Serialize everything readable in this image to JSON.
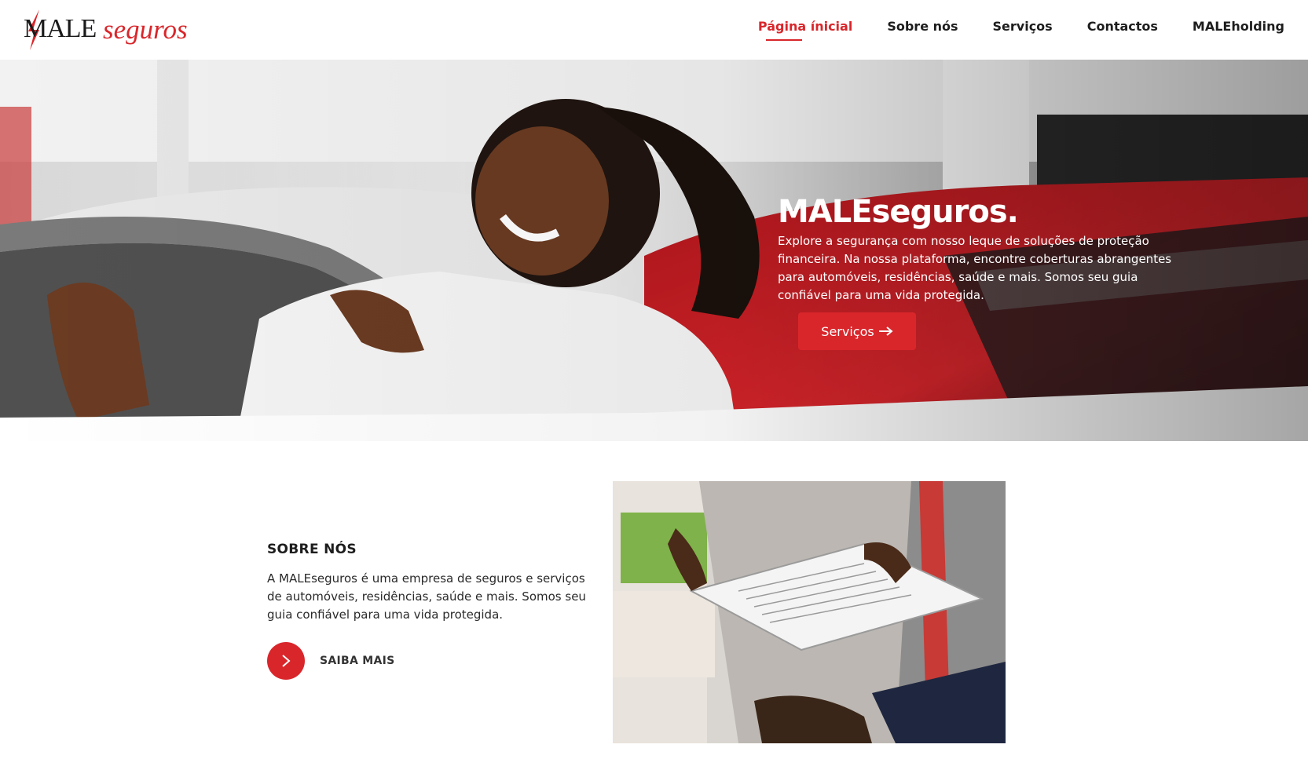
{
  "brand": {
    "logo_text_main": "MALE",
    "logo_text_accent": "seguros",
    "accent_color": "#d9262b"
  },
  "nav": {
    "items": [
      {
        "label": "Página ínicial",
        "active": true
      },
      {
        "label": "Sobre nós",
        "active": false
      },
      {
        "label": "Serviços",
        "active": false
      },
      {
        "label": "Contactos",
        "active": false
      },
      {
        "label": "MALEholding",
        "active": false
      }
    ]
  },
  "hero": {
    "title": "MALEseguros.",
    "text": "Explore a segurança com nosso leque de soluções de proteção financeira. Na nossa plataforma, encontre coberturas abrangentes para automóveis, residências, saúde e mais. Somos seu guia confiável para uma vida protegida.",
    "button_label": "Serviços",
    "button_icon": "arrow-right-icon",
    "image": "woman-laughing-in-car-photo"
  },
  "about": {
    "heading": "SOBRE NÓS",
    "text": "A MALEseguros é uma empresa de seguros e serviços de automóveis, residências, saúde e mais. Somos seu guia confiável para uma vida protegida.",
    "link_label": "SAIBA MAIS",
    "link_icon": "chevron-right-icon",
    "image": "people-reviewing-documents-photo"
  }
}
